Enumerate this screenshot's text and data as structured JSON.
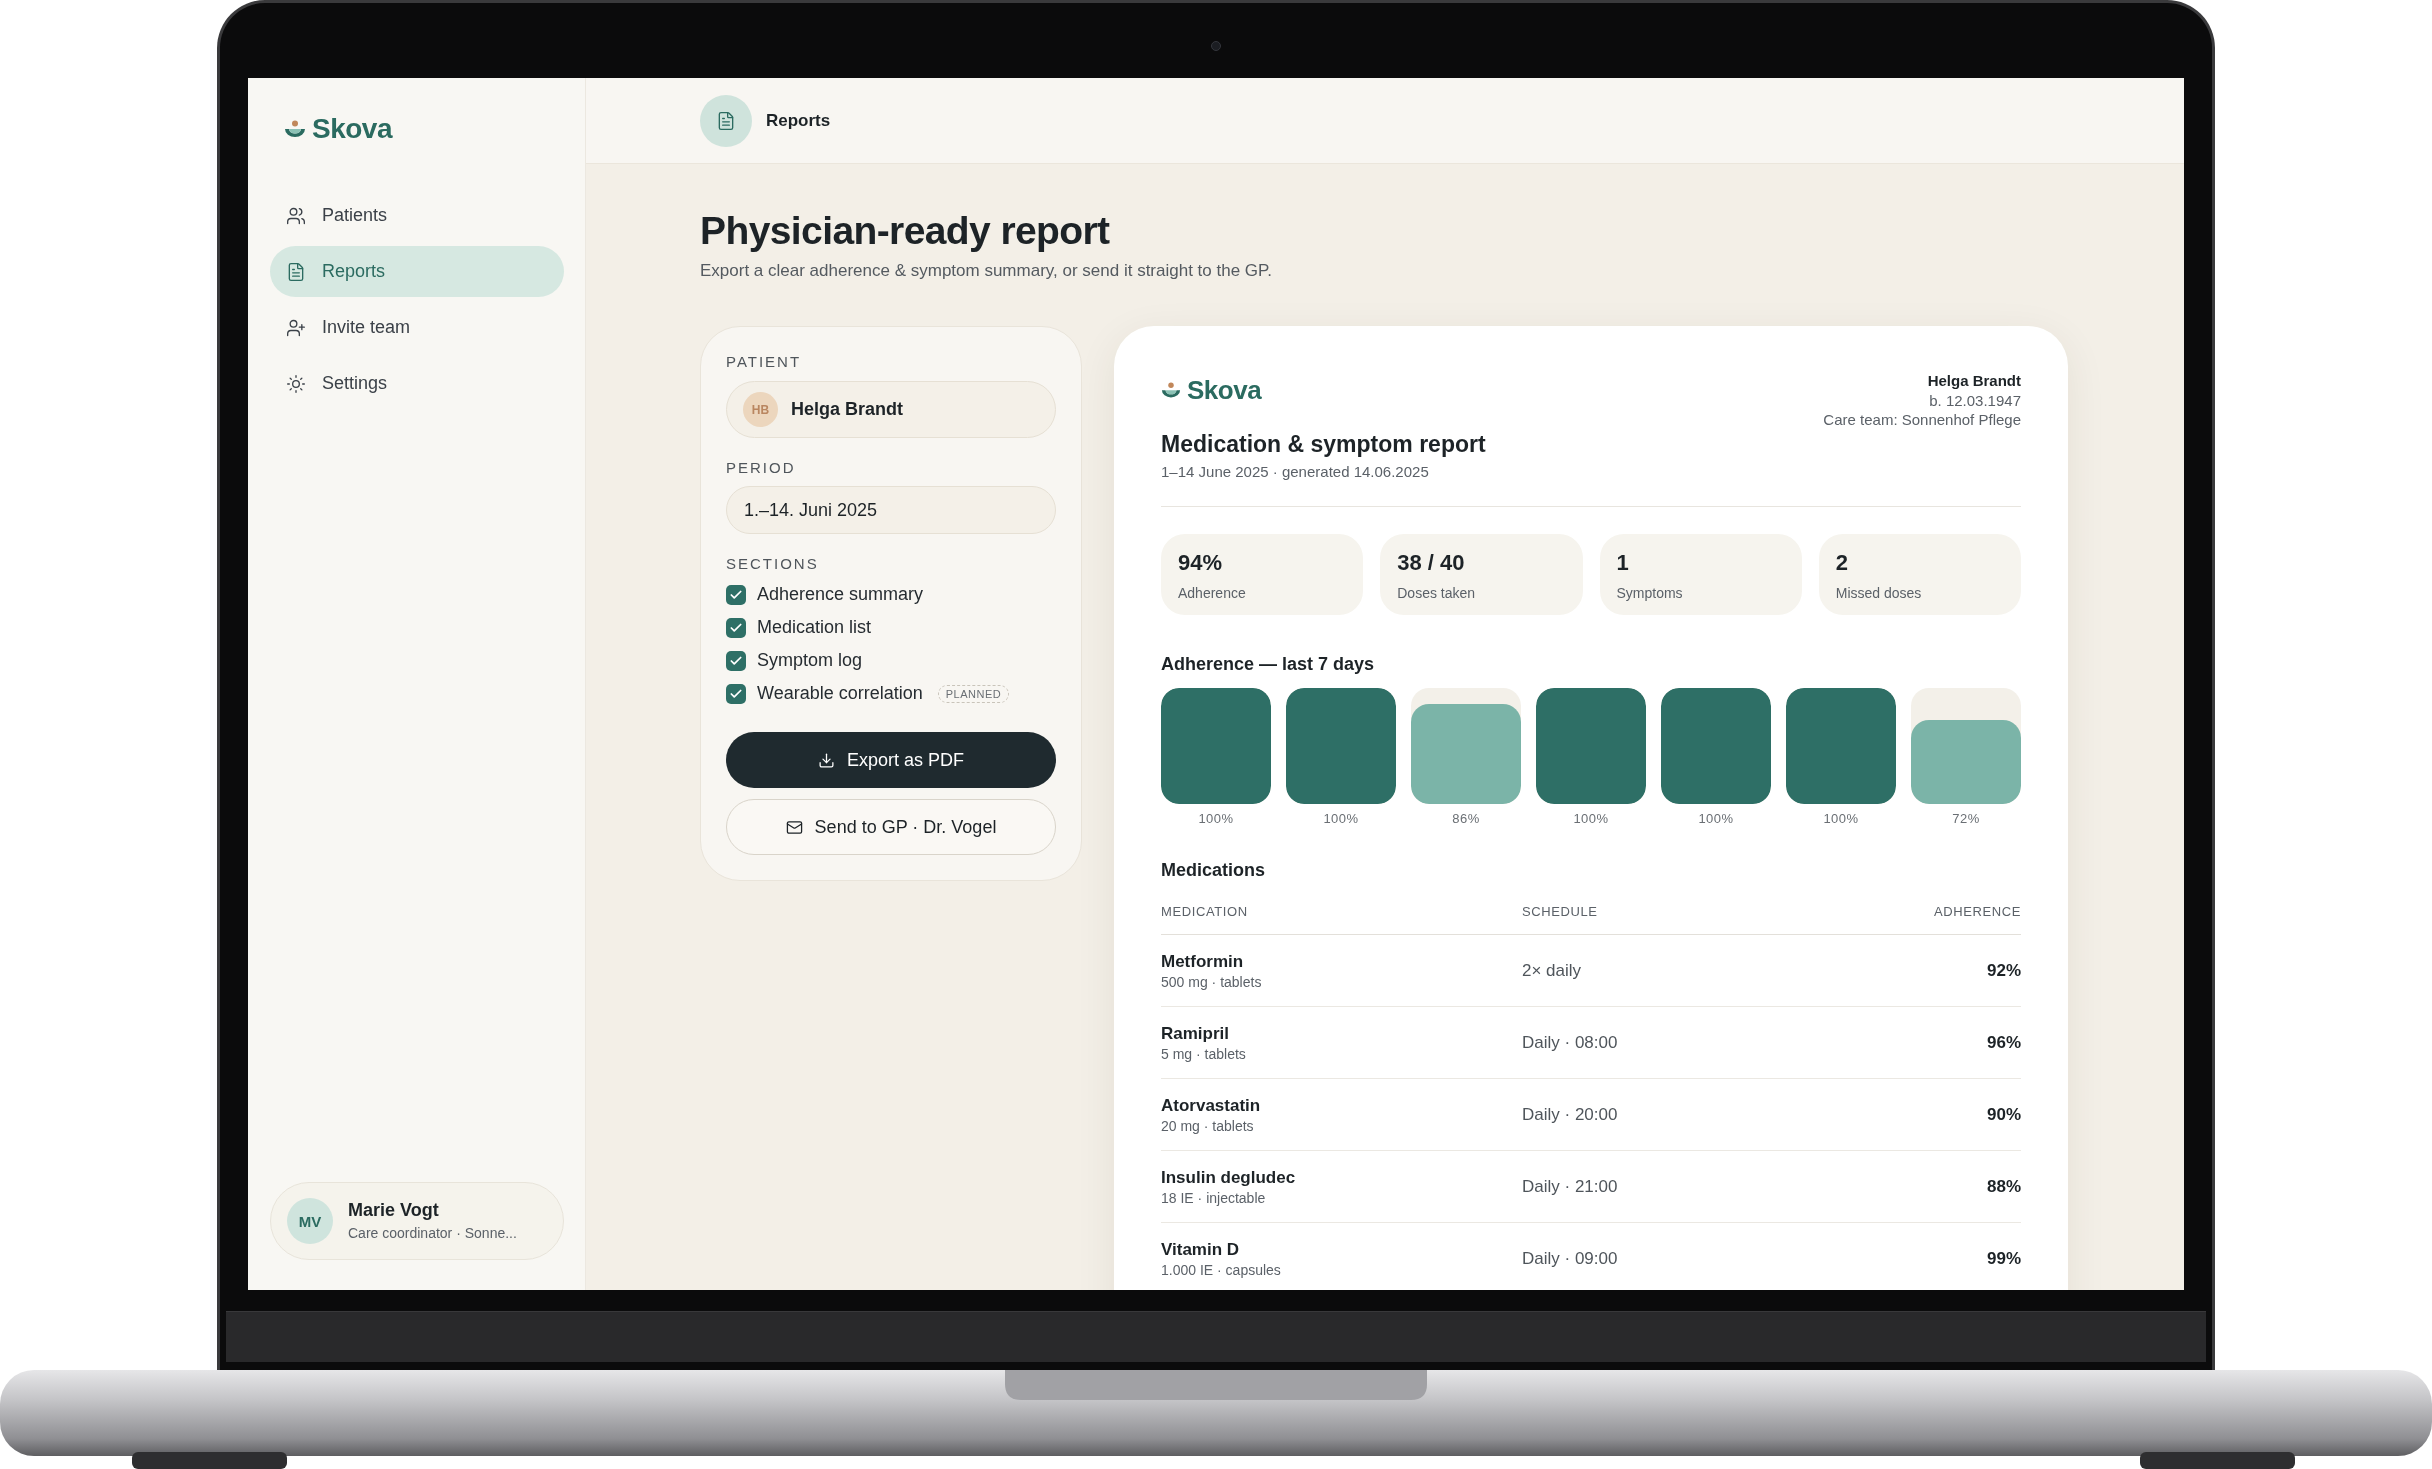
{
  "sidebar": {
    "logo": "Skova",
    "nav": [
      {
        "label": "Patients",
        "selected": false
      },
      {
        "label": "Reports",
        "selected": true
      },
      {
        "label": "Invite team",
        "selected": false
      },
      {
        "label": "Settings",
        "selected": false
      }
    ],
    "user": {
      "initials": "MV",
      "name": "Marie Vogt",
      "role": "Care coordinator · Sonne..."
    }
  },
  "header": {
    "title": "Reports"
  },
  "page": {
    "title": "Physician-ready report",
    "subtitle": "Export a clear adherence & symptom summary, or send it straight to the GP."
  },
  "export_panel": {
    "patient_label": "PATIENT",
    "patient": {
      "initials": "HB",
      "name": "Helga Brandt"
    },
    "period_label": "PERIOD",
    "period": {
      "value": "1.–14. Juni 2025"
    },
    "sections_label": "SECTIONS",
    "sections": [
      {
        "label": "Adherence summary",
        "checked": true
      },
      {
        "label": "Medication list",
        "checked": true
      },
      {
        "label": "Symptom log",
        "checked": true
      },
      {
        "label": "Wearable correlation",
        "checked": true,
        "badge": "PLANNED"
      }
    ],
    "buttons": [
      {
        "kind": "export",
        "label": "Export as PDF"
      },
      {
        "kind": "send",
        "label": "Send to GP · Dr. Vogel"
      }
    ]
  },
  "report": {
    "logo": "Skova",
    "title": "Medication & symptom report",
    "subtitle": "1–14 June 2025 · generated 14.06.2025",
    "patient": {
      "name": "Helga Brandt",
      "birth": "b. 12.03.1947",
      "care_team": "Care team: Sonnenhof Pflege"
    },
    "stats": [
      {
        "value": "94%",
        "label": "Adherence"
      },
      {
        "value": "38 / 40",
        "label": "Doses taken"
      },
      {
        "value": "1",
        "label": "Symptoms"
      },
      {
        "value": "2",
        "label": "Missed doses"
      }
    ],
    "adherence": {
      "title": "Adherence — last 7 days",
      "days": [
        {
          "level": 1,
          "reading": "100%"
        },
        {
          "level": 1,
          "reading": "100%"
        },
        {
          "level": 0.86,
          "reading": "86%"
        },
        {
          "level": 1,
          "reading": "100%"
        },
        {
          "level": 1,
          "reading": "100%"
        },
        {
          "level": 1,
          "reading": "100%"
        },
        {
          "level": 0.72,
          "reading": "72%"
        }
      ]
    },
    "medications": {
      "title": "Medications",
      "columns": [
        "MEDICATION",
        "SCHEDULE",
        "ADHERENCE"
      ],
      "rows": [
        {
          "name": "Metformin",
          "dose": "500 mg · tablets",
          "schedule": "2× daily",
          "adherence": "92%"
        },
        {
          "name": "Ramipril",
          "dose": "5 mg · tablets",
          "schedule": "Daily · 08:00",
          "adherence": "96%"
        },
        {
          "name": "Atorvastatin",
          "dose": "20 mg · tablets",
          "schedule": "Daily · 20:00",
          "adherence": "90%"
        },
        {
          "name": "Insulin degludec",
          "dose": "18 IE · injectable",
          "schedule": "Daily · 21:00",
          "adherence": "88%"
        },
        {
          "name": "Vitamin D",
          "dose": "1.000 IE · capsules",
          "schedule": "Daily · 09:00",
          "adherence": "99%"
        }
      ]
    }
  }
}
